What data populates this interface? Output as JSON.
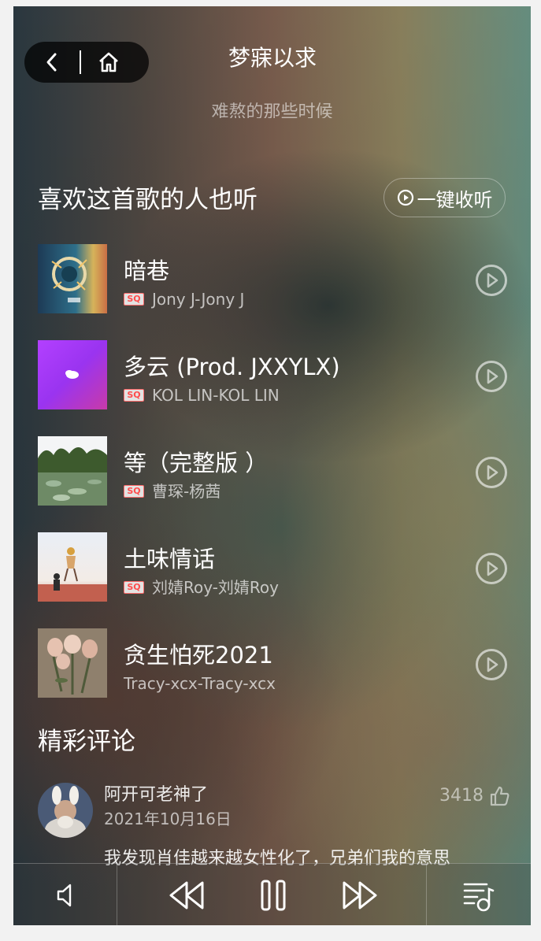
{
  "header": {
    "title": "梦寐以求",
    "lyric_line": "难熬的那些时候"
  },
  "similar": {
    "section_title": "喜欢这首歌的人也听",
    "listen_all_label": "一键收听",
    "songs": [
      {
        "name": "暗巷",
        "artist": "Jony J-Jony J",
        "sq": true,
        "cover": "album-cover-ring"
      },
      {
        "name": "多云 (Prod. JXXYLX)",
        "artist": "KOL LIN-KOL LIN",
        "sq": true,
        "cover": "album-cover-purple-cloud"
      },
      {
        "name": "等（完整版 ）",
        "artist": "曹琛-杨茜",
        "sq": true,
        "cover": "album-cover-lily-pond"
      },
      {
        "name": "土味情话",
        "artist": "刘婧Roy-刘婧Roy",
        "sq": true,
        "cover": "album-cover-beach-kids"
      },
      {
        "name": "贪生怕死2021",
        "artist": "Tracy-xcx-Tracy-xcx",
        "sq": false,
        "cover": "album-cover-roses"
      }
    ],
    "sq_badge": "SQ"
  },
  "comments": {
    "section_title": "精彩评论",
    "items": [
      {
        "user": "阿开可老神了",
        "date": "2021年10月16日",
        "likes": "3418",
        "text": "我发现肖佳越来越女性化了，兄弟们我的意思"
      }
    ]
  },
  "colors": {
    "sq_red": "#ff4d4d",
    "text": "#ffffff"
  }
}
